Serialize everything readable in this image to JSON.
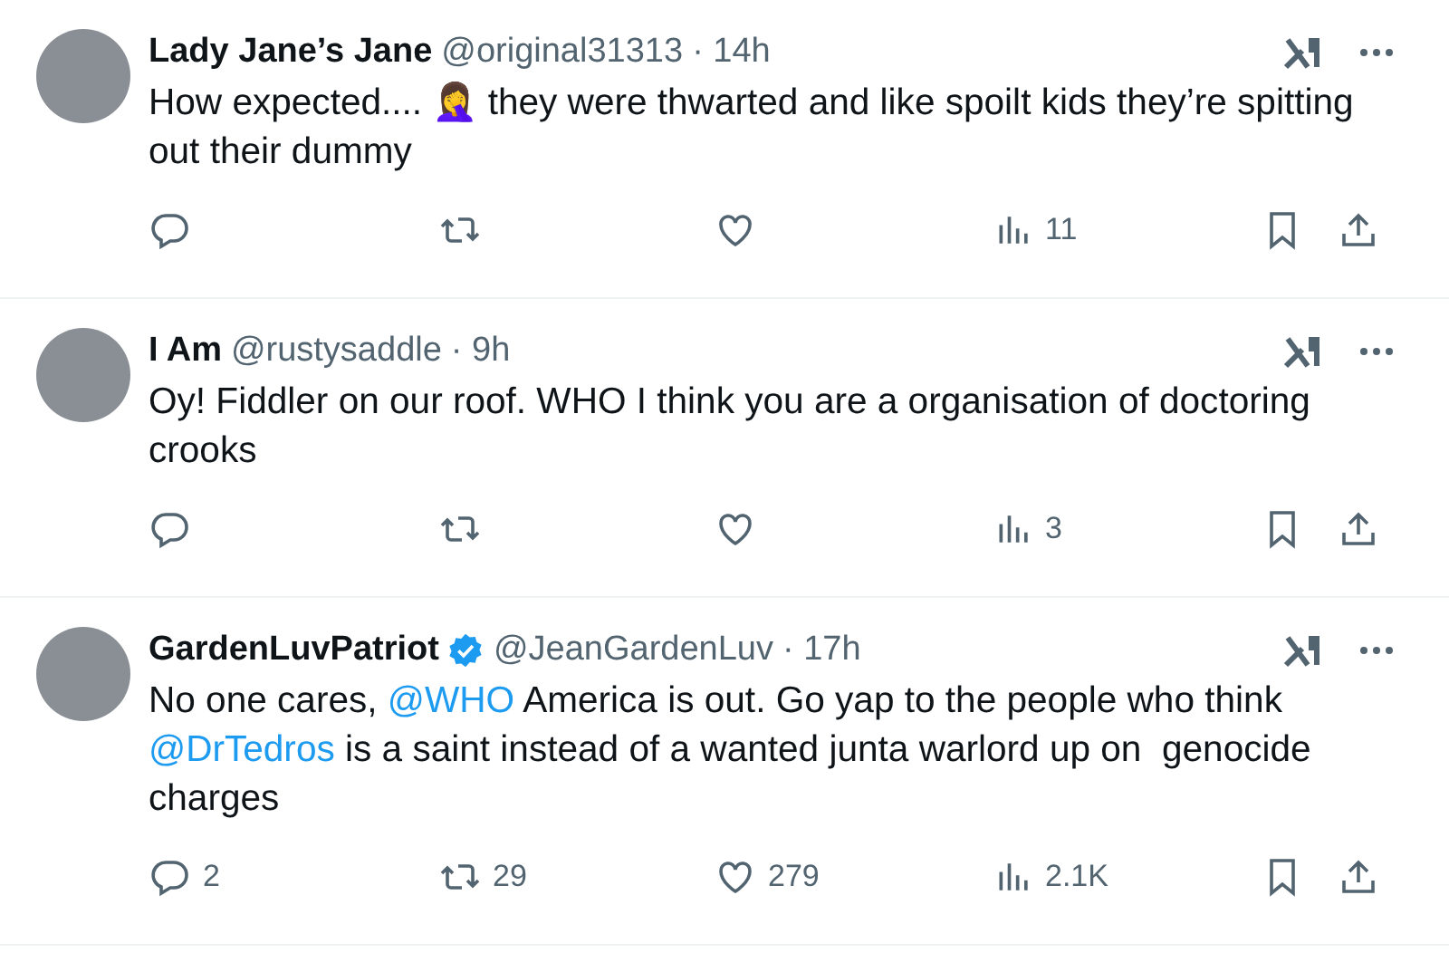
{
  "tweets": [
    {
      "name": "Lady Jane’s Jane",
      "verified": false,
      "handle": "@original31313",
      "time": "· 14h",
      "body": [
        {
          "kind": "text",
          "text": "How expected.... 🤦‍♀️ they were thwarted and like spoilt kids they’re spitting out their dummy"
        }
      ],
      "views": "11"
    },
    {
      "name": "I Am",
      "verified": false,
      "handle": "@rustysaddle",
      "time": "· 9h",
      "body": [
        {
          "kind": "text",
          "text": "Oy! Fiddler on our roof. WHO I think you are a organisation of doctoring crooks"
        }
      ],
      "views": "3"
    },
    {
      "name": "GardenLuvPatriot",
      "verified": true,
      "handle": "@JeanGardenLuv",
      "time": "· 17h",
      "body": [
        {
          "kind": "text",
          "text": "No one cares, "
        },
        {
          "kind": "mention",
          "text": "@WHO"
        },
        {
          "kind": "text",
          "text": " America is out. Go yap to the people who think "
        },
        {
          "kind": "mention",
          "text": "@DrTedros"
        },
        {
          "kind": "text",
          "text": " is a saint instead of a wanted junta warlord up on  genocide charges"
        }
      ],
      "replies": "2",
      "reposts": "29",
      "likes": "279",
      "views": "2.1K"
    }
  ]
}
